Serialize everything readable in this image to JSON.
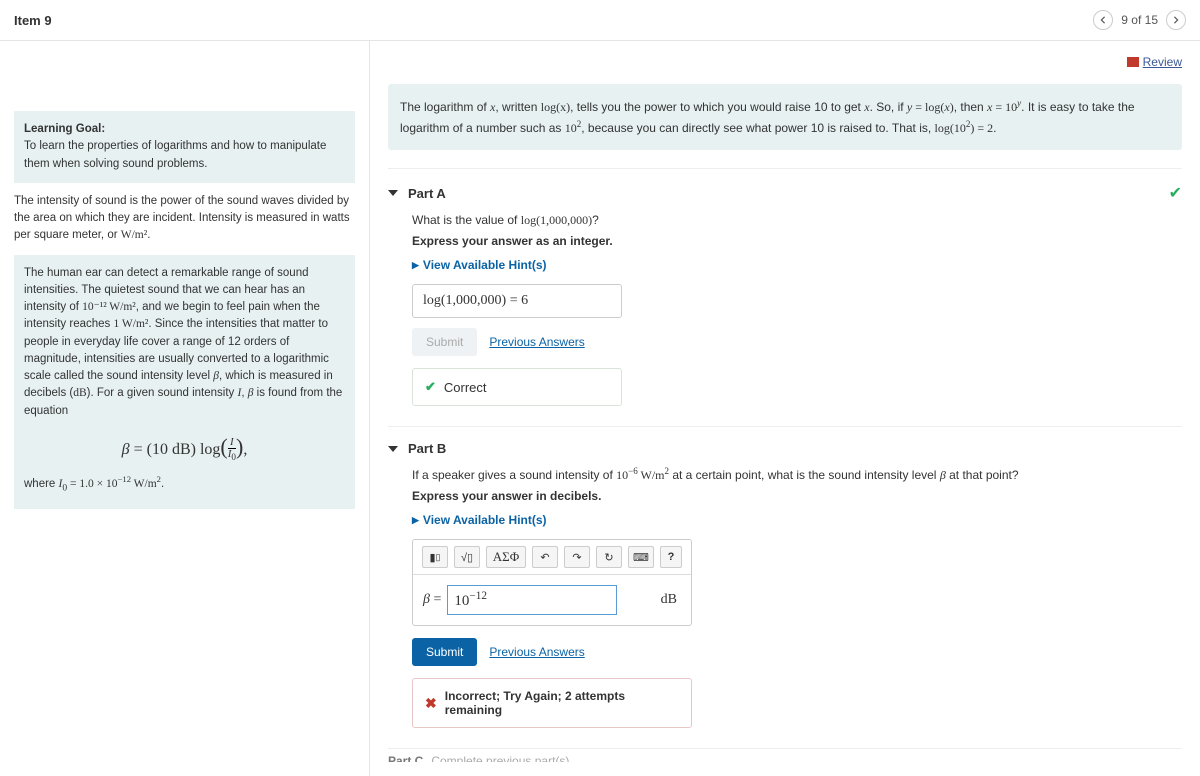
{
  "header": {
    "item": "Item 9",
    "position": "9 of 15"
  },
  "review": "Review",
  "sidebar": {
    "lg_title": "Learning Goal:",
    "lg_text": "To learn the properties of logarithms and how to manipulate them when solving sound problems.",
    "para1_a": "The intensity of sound is the power of the sound waves divided by the area on which they are incident. Intensity is measured in watts per square meter, or ",
    "para1_b": "W/m²",
    "para1_c": ".",
    "para2_a": "The human ear can detect a remarkable range of sound intensities. The quietest sound that we can hear has an intensity of ",
    "para2_b": "10⁻¹² W/m²",
    "para2_c": ", and we begin to feel pain when the intensity reaches ",
    "para2_d": "1 W/m²",
    "para2_e": ". Since the intensities that matter to people in everyday life cover a range of 12 orders of magnitude, intensities are usually converted to a logarithmic scale called the sound intensity level ",
    "para2_f": "β",
    "para2_g": ", which is measured in decibels (",
    "para2_h": "dB",
    "para2_i": "). For a given sound intensity ",
    "para2_j": "I",
    "para2_k": ", ",
    "para2_l": "β",
    "para2_m": " is found from the equation",
    "eqn": "β = (10 dB) log( I / I₀ ),",
    "where_a": "where ",
    "where_b": "I₀ = 1.0 × 10⁻¹² W/m²",
    "where_c": "."
  },
  "intro": {
    "a": "The logarithm of ",
    "b": "x",
    "c": ", written ",
    "d": "log(x)",
    "e": ", tells you the power to which you would raise 10 to get ",
    "f": "x",
    "g": ". So, if ",
    "h": "y = log(x)",
    "i": ", then ",
    "j": "x = 10",
    "k": "y",
    "l": ". It is easy to take the logarithm of a number such as ",
    "m": "10²",
    "n": ", because you can directly see what power 10 is raised to. That is, ",
    "o": "log(10²) = 2",
    "p": "."
  },
  "partA": {
    "title": "Part A",
    "q_a": "What is the value of ",
    "q_b": "log(1,000,000)",
    "q_c": "?",
    "instr": "Express your answer as an integer.",
    "hints": "View Available Hint(s)",
    "answer_a": "log(1,000,000)",
    "answer_b": " = ",
    "answer_c": "6",
    "submit": "Submit",
    "prev": "Previous Answers",
    "correct": "Correct"
  },
  "partB": {
    "title": "Part B",
    "q_a": "If a speaker gives a sound intensity of ",
    "q_b": "10⁻⁶ W/m²",
    "q_c": " at a certain point, what is the sound intensity level ",
    "q_d": "β",
    "q_e": " at that point?",
    "instr": "Express your answer in decibels.",
    "hints": "View Available Hint(s)",
    "beta_label": "β",
    "equals": " = ",
    "input_value": "10⁻¹²",
    "unit": "dB",
    "greek_btn": "ΑΣΦ",
    "q_btn": "?",
    "submit": "Submit",
    "prev": "Previous Answers",
    "incorrect": "Incorrect; Try Again; 2 attempts remaining"
  },
  "partC": {
    "label": "Part C",
    "msg": "Complete previous part(s)"
  }
}
